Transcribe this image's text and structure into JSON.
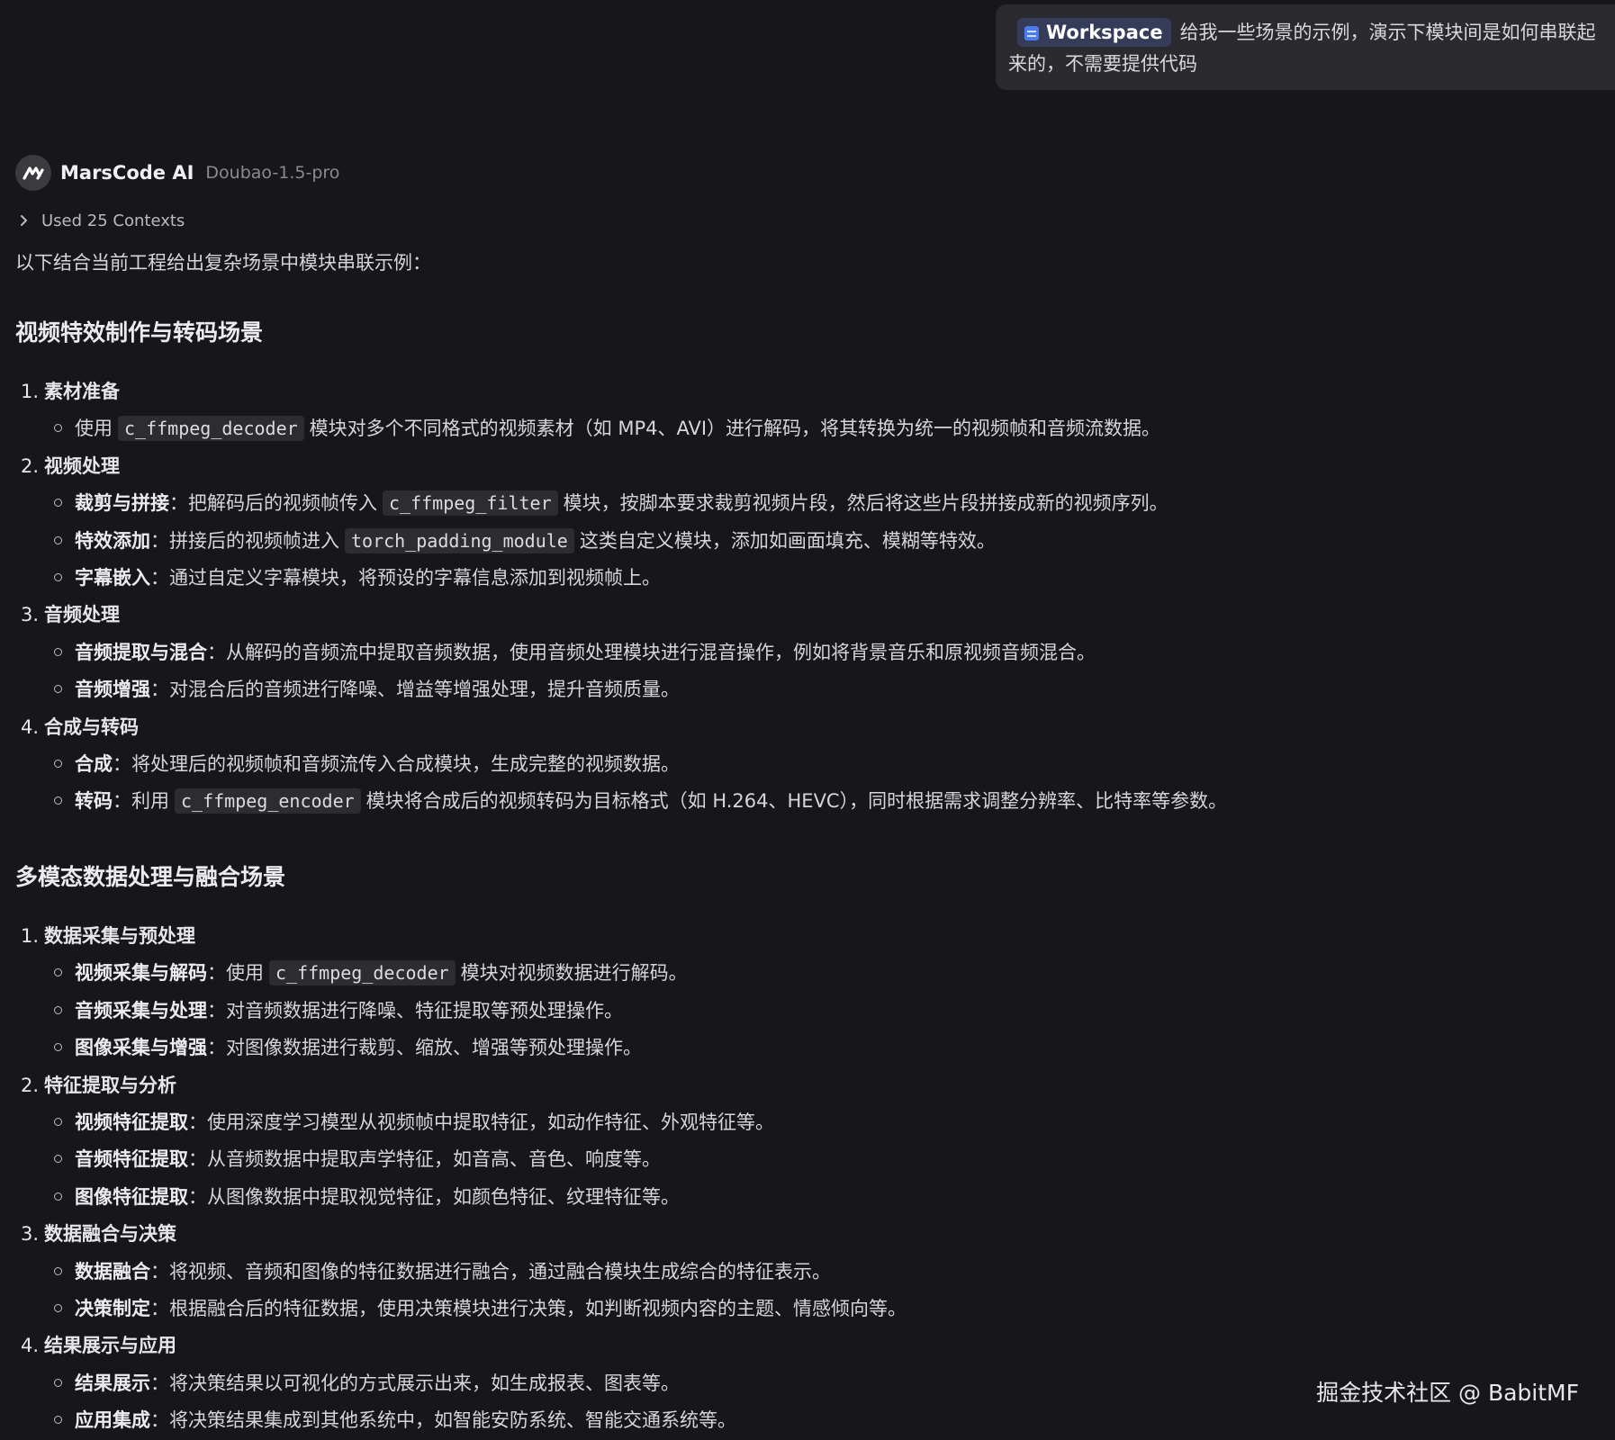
{
  "user_message": {
    "chip_label": "Workspace",
    "line1": "给我一些场景的示例，演示下模块间是如何串联起",
    "line2": "来的，不需要提供代码"
  },
  "assistant": {
    "name": "MarsCode AI",
    "model": "Doubao-1.5-pro",
    "contexts_label": "Used 25 Contexts",
    "intro": "以下结合当前工程给出复杂场景中模块串联示例："
  },
  "sections": [
    {
      "title": "视频特效制作与转码场景",
      "steps": [
        {
          "num": "1.",
          "title": "素材准备",
          "bullets": [
            {
              "bold": "",
              "pre": "使用",
              "code": "c_ffmpeg_decoder",
              "post": "模块对多个不同格式的视频素材（如 MP4、AVI）进行解码，将其转换为统一的视频帧和音频流数据。"
            }
          ]
        },
        {
          "num": "2.",
          "title": "视频处理",
          "bullets": [
            {
              "bold": "裁剪与拼接",
              "pre": "：把解码后的视频帧传入",
              "code": "c_ffmpeg_filter",
              "post": "模块，按脚本要求裁剪视频片段，然后将这些片段拼接成新的视频序列。"
            },
            {
              "bold": "特效添加",
              "pre": "：拼接后的视频帧进入",
              "code": "torch_padding_module",
              "post": "这类自定义模块，添加如画面填充、模糊等特效。"
            },
            {
              "bold": "字幕嵌入",
              "pre": "：通过自定义字幕模块，将预设的字幕信息添加到视频帧上。",
              "code": "",
              "post": ""
            }
          ]
        },
        {
          "num": "3.",
          "title": "音频处理",
          "bullets": [
            {
              "bold": "音频提取与混合",
              "pre": "：从解码的音频流中提取音频数据，使用音频处理模块进行混音操作，例如将背景音乐和原视频音频混合。",
              "code": "",
              "post": ""
            },
            {
              "bold": "音频增强",
              "pre": "：对混合后的音频进行降噪、增益等增强处理，提升音频质量。",
              "code": "",
              "post": ""
            }
          ]
        },
        {
          "num": "4.",
          "title": "合成与转码",
          "bullets": [
            {
              "bold": "合成",
              "pre": "：将处理后的视频帧和音频流传入合成模块，生成完整的视频数据。",
              "code": "",
              "post": ""
            },
            {
              "bold": "转码",
              "pre": "：利用",
              "code": "c_ffmpeg_encoder",
              "post": "模块将合成后的视频转码为目标格式（如 H.264、HEVC），同时根据需求调整分辨率、比特率等参数。"
            }
          ]
        }
      ]
    },
    {
      "title": "多模态数据处理与融合场景",
      "steps": [
        {
          "num": "1.",
          "title": "数据采集与预处理",
          "bullets": [
            {
              "bold": "视频采集与解码",
              "pre": "：使用",
              "code": "c_ffmpeg_decoder",
              "post": "模块对视频数据进行解码。"
            },
            {
              "bold": "音频采集与处理",
              "pre": "：对音频数据进行降噪、特征提取等预处理操作。",
              "code": "",
              "post": ""
            },
            {
              "bold": "图像采集与增强",
              "pre": "：对图像数据进行裁剪、缩放、增强等预处理操作。",
              "code": "",
              "post": ""
            }
          ]
        },
        {
          "num": "2.",
          "title": "特征提取与分析",
          "bullets": [
            {
              "bold": "视频特征提取",
              "pre": "：使用深度学习模型从视频帧中提取特征，如动作特征、外观特征等。",
              "code": "",
              "post": ""
            },
            {
              "bold": "音频特征提取",
              "pre": "：从音频数据中提取声学特征，如音高、音色、响度等。",
              "code": "",
              "post": ""
            },
            {
              "bold": "图像特征提取",
              "pre": "：从图像数据中提取视觉特征，如颜色特征、纹理特征等。",
              "code": "",
              "post": ""
            }
          ]
        },
        {
          "num": "3.",
          "title": "数据融合与决策",
          "bullets": [
            {
              "bold": "数据融合",
              "pre": "：将视频、音频和图像的特征数据进行融合，通过融合模块生成综合的特征表示。",
              "code": "",
              "post": ""
            },
            {
              "bold": "决策制定",
              "pre": "：根据融合后的特征数据，使用决策模块进行决策，如判断视频内容的主题、情感倾向等。",
              "code": "",
              "post": ""
            }
          ]
        },
        {
          "num": "4.",
          "title": "结果展示与应用",
          "bullets": [
            {
              "bold": "结果展示",
              "pre": "：将决策结果以可视化的方式展示出来，如生成报表、图表等。",
              "code": "",
              "post": ""
            },
            {
              "bold": "应用集成",
              "pre": "：将决策结果集成到其他系统中，如智能安防系统、智能交通系统等。",
              "code": "",
              "post": ""
            }
          ]
        }
      ]
    }
  ],
  "watermark": "掘金技术社区 @ BabitMF"
}
